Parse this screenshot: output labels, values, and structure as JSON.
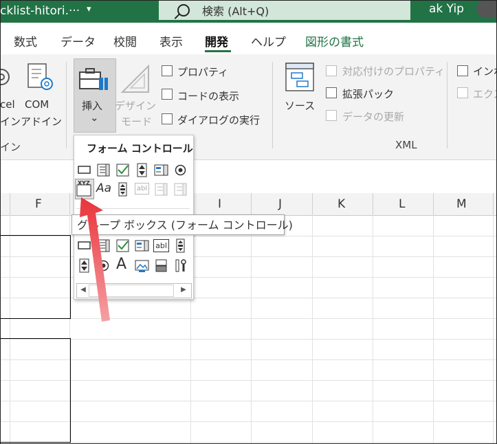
{
  "window": {
    "doc_title": "cklist-hitori.···",
    "title_caret": "▾"
  },
  "search": {
    "text": "検索 (Alt+Q)"
  },
  "user": {
    "name": "ak Yip"
  },
  "tabs": [
    {
      "label": "数式"
    },
    {
      "label": "データ"
    },
    {
      "label": "校閲"
    },
    {
      "label": "表示"
    },
    {
      "label": "開発",
      "active": true
    },
    {
      "label": "ヘルプ"
    },
    {
      "label": "図形の書式"
    }
  ],
  "ribbon": {
    "addins_group": {
      "excel_addins_line1": "cel",
      "excel_addins_line2": "イン",
      "com_line1": "COM",
      "com_line2": "アドイン",
      "group_label": "イン"
    },
    "controls_group": {
      "insert_label": "挿入",
      "insert_caret": "⌄",
      "design_mode_line1": "デザイン",
      "design_mode_line2": "モード",
      "properties": "プロパティ",
      "view_code": "コードの表示",
      "run_dialog": "ダイアログの実行"
    },
    "xml_group": {
      "source": "ソース",
      "map_properties": "対応付けのプロパティ",
      "expansion_packs": "拡張パック",
      "refresh_data": "データの更新",
      "import": "インポ",
      "export": "エクス",
      "group_label": "XML"
    }
  },
  "columns": [
    "F",
    "I",
    "J",
    "K",
    "L",
    "M"
  ],
  "popup": {
    "form_controls_title": "フォーム コントロール",
    "tooltip": "グループ ボックス (フォーム コントロール)",
    "groupbox_icon_text": "XYZ",
    "label_icon_text": "Aa",
    "text_icon_text": "abl",
    "activex_label_icon_text": "A",
    "scroll_left": "◀",
    "scroll_right": "▶"
  },
  "colors": {
    "accent": "#217346",
    "arrow": "#e8333a"
  }
}
